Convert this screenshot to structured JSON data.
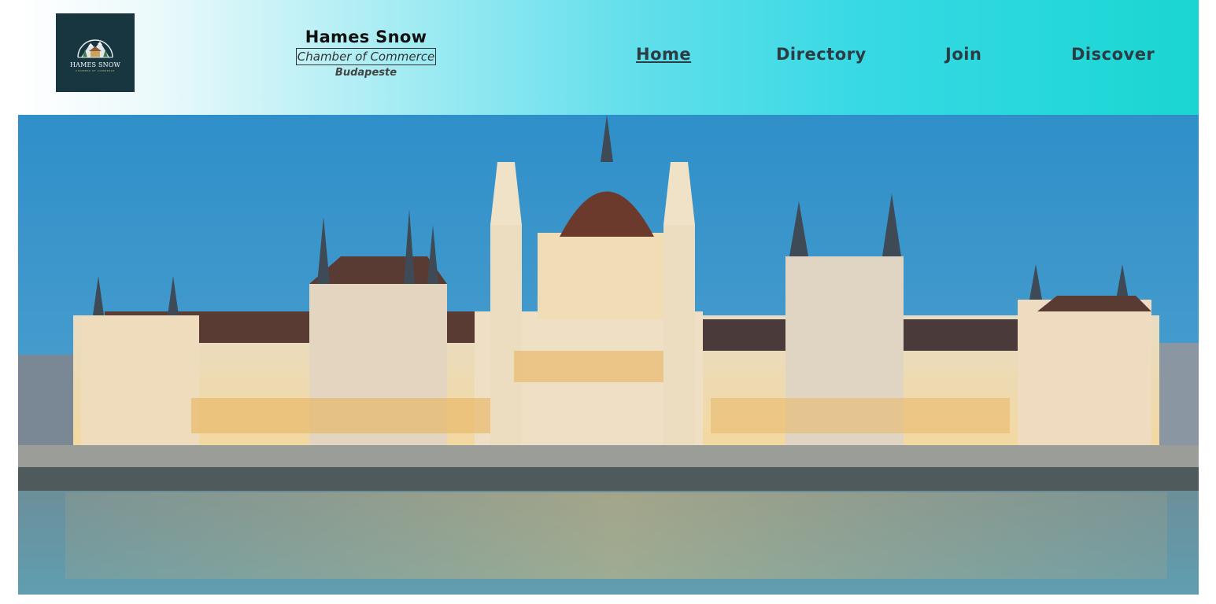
{
  "logo": {
    "name": "HAMES SNOW",
    "subtitle": "CHAMBER OF COMMERCE",
    "icon": "mountain-house-logo-icon",
    "background": "#17363f"
  },
  "brand": {
    "title": "Hames Snow",
    "subtitle": "Chamber of Commerce",
    "city": "Budapeste"
  },
  "nav": {
    "items": [
      {
        "label": "Home",
        "active": true
      },
      {
        "label": "Directory",
        "active": false
      },
      {
        "label": "Join",
        "active": false
      },
      {
        "label": "Discover",
        "active": false
      }
    ]
  },
  "hero": {
    "subject": "hungarian-parliament-building-image"
  },
  "colors": {
    "header_gradient_start": "#ffffff",
    "header_gradient_end": "#1ad6d2",
    "nav_text": "#2c3c44"
  }
}
